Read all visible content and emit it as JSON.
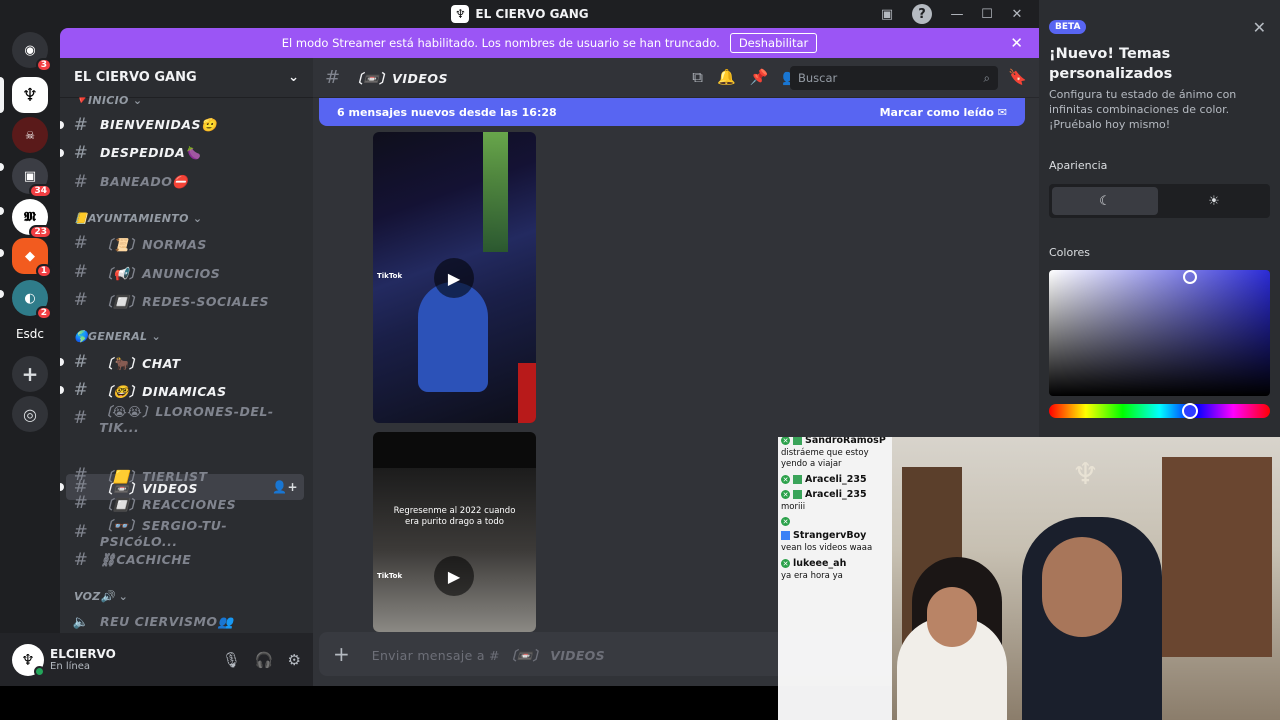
{
  "window": {
    "title": "EL CIERVO GANG",
    "logo_glyph": "♆"
  },
  "banner": {
    "text": "El modo Streamer está habilitado. Los nombres de usuario se han truncado.",
    "button": "Deshabilitar",
    "close": "✕"
  },
  "rail": {
    "servers": [
      {
        "glyph": "◉",
        "color": "#5865f2",
        "badge": "3"
      },
      {
        "glyph": "♆",
        "color": "#ffffff",
        "badge": ""
      },
      {
        "glyph": "☠",
        "color": "#5a1a1a",
        "badge": ""
      },
      {
        "glyph": "▣",
        "color": "#3b3d44",
        "badge": "34"
      },
      {
        "glyph": "𝕸",
        "color": "#ffffff",
        "badge": "23"
      },
      {
        "glyph": "◆",
        "color": "#f25b1f",
        "badge": "1"
      },
      {
        "glyph": "◐",
        "color": "#2f7c8a",
        "badge": "2"
      },
      {
        "glyph": "Esdc",
        "color": "#1e1f22",
        "badge": ""
      },
      {
        "glyph": "+",
        "color": "#313338",
        "badge": ""
      },
      {
        "glyph": "◎",
        "color": "#313338",
        "badge": ""
      }
    ]
  },
  "guild": {
    "name": "EL CIERVO GANG",
    "chevron": "⌄"
  },
  "channels": {
    "cat_inicio": "🔻INICIO ⌄",
    "cat_ayuntamiento": "📒AYUNTAMIENTO ⌄",
    "cat_general": "🌎GENERAL ⌄",
    "cat_voz": "VOZ🔊 ⌄",
    "items": [
      {
        "label": "BIENVENIDAS🫡"
      },
      {
        "label": "DESPEDIDA🍆"
      },
      {
        "label": "BANEADO⛔"
      },
      {
        "label": "〔📜〕NORMAS"
      },
      {
        "label": "〔📢〕ANUNCIOS"
      },
      {
        "label": "〔🔲〕REDES-SOCIALES"
      },
      {
        "label": "〔🐂〕CHAT"
      },
      {
        "label": "〔🤓〕DINAMICAS"
      },
      {
        "label": "〔😭😭〕LLORONES-DEL-TIK..."
      },
      {
        "label": "〔📼〕VIDEOS"
      },
      {
        "label": "〔🟨〕TIERLIST"
      },
      {
        "label": "〔🔲〕REACCIONES"
      },
      {
        "label": "〔👓〕SERGIO-TU-PSICóLO..."
      },
      {
        "label": "⛓CACHICHE"
      },
      {
        "label": "REU CIERVISMO👥"
      }
    ]
  },
  "user": {
    "name": "ELCIERVO",
    "status": "En línea"
  },
  "chat": {
    "channel": "〔📼〕VIDEOS",
    "search_placeholder": "Buscar",
    "new_messages": "6 mensajes nuevos desde las 16:28",
    "mark_read": "Marcar como leído",
    "video2_caption": "Regresenme al 2022 cuando era purito drago a todo",
    "tiktok_label": "TikTok",
    "composer_prefix": "Enviar mensaje a # ",
    "composer_channel": "〔📼〕 VIDEOS"
  },
  "theme_panel": {
    "badge": "BETA",
    "title": "¡Nuevo! Temas personalizados",
    "description": "Configura tu estado de ánimo con infinitas combinaciones de color. ¡Pruébalo hoy mismo!",
    "appearance_label": "Apariencia",
    "colors_label": "Colores",
    "hue_level": 0.64
  },
  "stream_chat": {
    "messages": [
      {
        "user": "SandroRamosP",
        "text": "distráeme que estoy yendo a viajar"
      },
      {
        "user": "Araceli_235",
        "text": ""
      },
      {
        "user": "Araceli_235",
        "text": "moriii"
      },
      {
        "user": "",
        "text": ""
      },
      {
        "user": "StrangervBoy",
        "text": "vean los videos waaa"
      },
      {
        "user": "lukeee_ah",
        "text": "ya era hora ya"
      }
    ]
  }
}
